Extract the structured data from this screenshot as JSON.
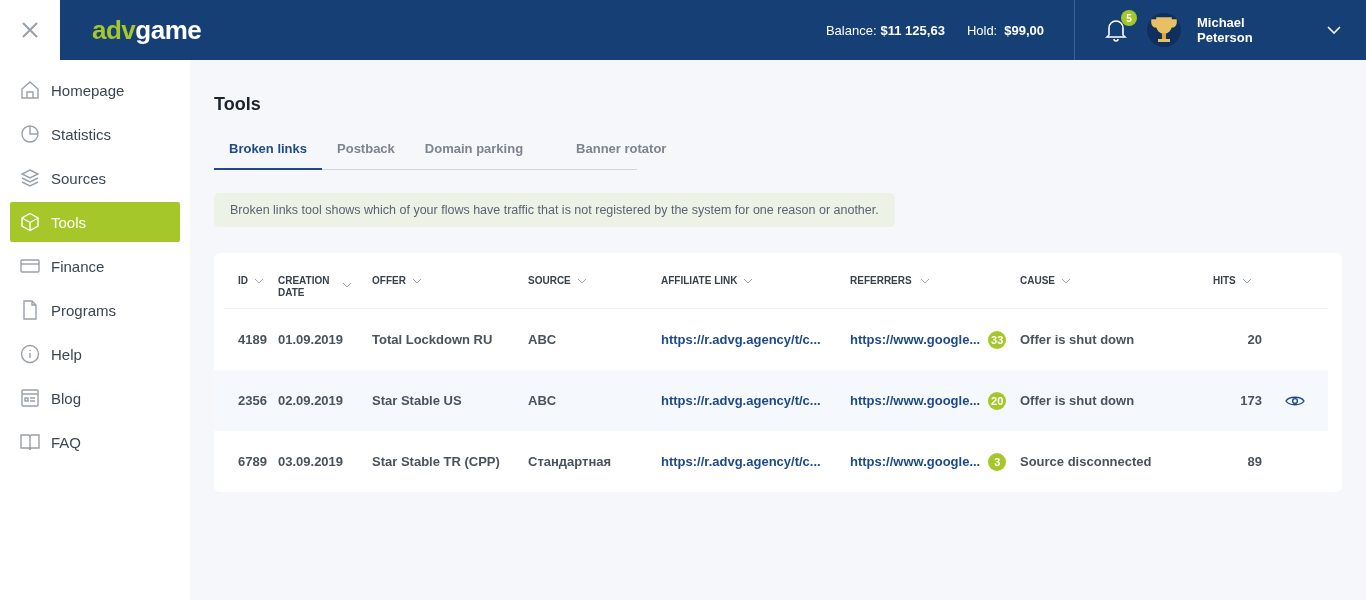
{
  "logo": {
    "accent": "adv",
    "rest": "game"
  },
  "header": {
    "balance_label": "Balance:",
    "balance": "$11 125,63",
    "hold_label": "Hold:",
    "hold": "$99,00",
    "notifications_count": "5",
    "user_name": "Michael Peterson"
  },
  "sidebar": {
    "items": [
      {
        "label": "Homepage",
        "kind": "home",
        "selected": false
      },
      {
        "label": "Statistics",
        "kind": "pie",
        "selected": false
      },
      {
        "label": "Sources",
        "kind": "layers",
        "selected": false
      },
      {
        "label": "Tools",
        "kind": "box",
        "selected": true
      },
      {
        "label": "Finance",
        "kind": "card",
        "selected": false
      },
      {
        "label": "Programs",
        "kind": "file",
        "selected": false
      },
      {
        "label": "Help",
        "kind": "info",
        "selected": false
      },
      {
        "label": "Blog",
        "kind": "blog",
        "selected": false
      },
      {
        "label": "FAQ",
        "kind": "book",
        "selected": false
      }
    ]
  },
  "page_title": "Tools",
  "tabs": [
    {
      "label": "Broken links",
      "selected": true
    },
    {
      "label": "Postback",
      "selected": false
    },
    {
      "label": "Domain parking",
      "selected": false
    },
    {
      "label": "Banner rotator",
      "selected": false
    }
  ],
  "notice": "Broken links tool shows which of your flows have traffic that is not registered by the system for one reason or another.",
  "table": {
    "columns": [
      "ID",
      "CREATION DATE",
      "OFFER",
      "SOURCE",
      "AFFILIATE LINK",
      "REFERRERS",
      "CAUSE",
      "HITS"
    ],
    "rows": [
      {
        "id": "4189",
        "date": "01.09.2019",
        "offer": "Total Lockdown RU",
        "source": "ABC",
        "affiliate_link": "https://r.advg.agency/t/c...",
        "referrer": "https://www.google...",
        "referrer_count": "33",
        "cause": "Offer is shut down",
        "hits": "20",
        "highlighted": false
      },
      {
        "id": "2356",
        "date": "02.09.2019",
        "offer": "Star Stable US",
        "source": "ABC",
        "affiliate_link": "https://r.advg.agency/t/c...",
        "referrer": "https://www.google...",
        "referrer_count": "20",
        "cause": "Offer is shut down",
        "hits": "173",
        "highlighted": true
      },
      {
        "id": "6789",
        "date": "03.09.2019",
        "offer": "Star Stable TR (CPP)",
        "source": "Стандартная",
        "affiliate_link": "https://r.advg.agency/t/c...",
        "referrer": "https://www.google...",
        "referrer_count": "3",
        "cause": "Source disconnected",
        "hits": "89",
        "highlighted": false
      }
    ]
  }
}
